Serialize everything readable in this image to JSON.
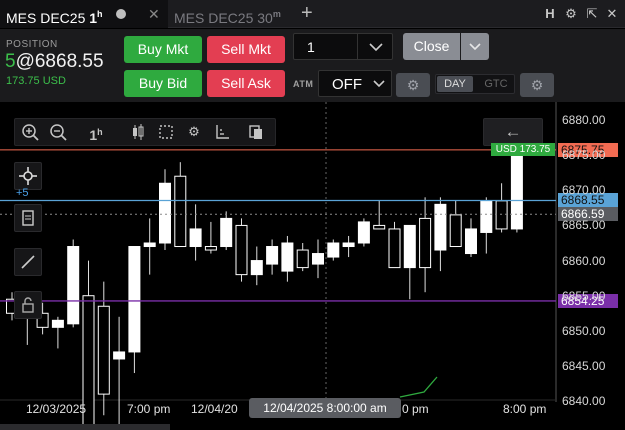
{
  "tabs": [
    {
      "symbol": "MES DEC25",
      "interval": "1",
      "interval_unit": "h",
      "active": true
    },
    {
      "symbol": "MES DEC25",
      "interval": "30",
      "interval_unit": "m",
      "active": false
    }
  ],
  "tab_icons": {
    "add": "+",
    "h": "H",
    "settings": "⚙",
    "popout": "⇱",
    "close": "✕"
  },
  "position": {
    "label": "POSITION",
    "qty": "5",
    "price": "@6868.55",
    "pnl": "173.75 USD"
  },
  "buttons": {
    "buy_mkt": "Buy Mkt",
    "sell_mkt": "Sell Mkt",
    "buy_bid": "Buy Bid",
    "sell_ask": "Sell Ask",
    "close": "Close"
  },
  "quantity": "1",
  "atm": {
    "label": "ATM",
    "value": "OFF"
  },
  "tif": {
    "day": "DAY",
    "gtc": "GTC"
  },
  "chart_toolbar": {
    "interval": "1",
    "interval_unit": "h"
  },
  "plus_offset": "+5",
  "price_tags": {
    "last": "6875.75",
    "entry": "6868.55",
    "crosshair": "6866.59",
    "alert": "6854.25",
    "pnl": "USD 173.75"
  },
  "colors": {
    "last": "#f26b52",
    "entry": "#5aa3d6",
    "crosshair": "#6a6c70",
    "alert": "#7a2fa8",
    "buy": "#2faa3f",
    "sell": "#e33e52"
  },
  "y_axis_labels": [
    "6880.00",
    "6875.00",
    "6870.00",
    "6865.00",
    "6860.00",
    "6855.00",
    "6850.00",
    "6845.00",
    "6840.00"
  ],
  "x_axis_labels": [
    "12/03/2025",
    "7:00 pm",
    "12/04/20",
    "0 pm",
    "8:00 pm"
  ],
  "crosshair_time": "12/04/2025 8:00:00 am",
  "chart_data": {
    "type": "candlestick",
    "ylim": [
      6840,
      6882
    ],
    "candles": [
      {
        "o": 6854.5,
        "h": 6855.5,
        "l": 6851.5,
        "c": 6852.5
      },
      {
        "o": 6852.0,
        "h": 6853.0,
        "l": 6848.0,
        "c": 6854.0
      },
      {
        "o": 6852.5,
        "h": 6854.0,
        "l": 6849.5,
        "c": 6850.5
      },
      {
        "o": 6850.5,
        "h": 6852.0,
        "l": 6847.5,
        "c": 6851.5
      },
      {
        "o": 6851.0,
        "h": 6863.0,
        "l": 6850.5,
        "c": 6862.0
      },
      {
        "o": 6855.0,
        "h": 6860.0,
        "l": 6835.0,
        "c": 6836.0
      },
      {
        "o": 6853.5,
        "h": 6857.0,
        "l": 6838.0,
        "c": 6841.0
      },
      {
        "o": 6846.0,
        "h": 6852.0,
        "l": 6836.0,
        "c": 6847.0
      },
      {
        "o": 6847.0,
        "h": 6862.0,
        "l": 6844.0,
        "c": 6862.0
      },
      {
        "o": 6862.0,
        "h": 6866.0,
        "l": 6858.0,
        "c": 6862.5
      },
      {
        "o": 6862.5,
        "h": 6873.0,
        "l": 6861.5,
        "c": 6871.0
      },
      {
        "o": 6872.0,
        "h": 6874.0,
        "l": 6862.0,
        "c": 6862.0
      },
      {
        "o": 6862.0,
        "h": 6868.0,
        "l": 6860.0,
        "c": 6864.5
      },
      {
        "o": 6862.0,
        "h": 6865.5,
        "l": 6861.0,
        "c": 6861.5
      },
      {
        "o": 6862.0,
        "h": 6867.0,
        "l": 6861.5,
        "c": 6866.0
      },
      {
        "o": 6865.0,
        "h": 6866.0,
        "l": 6857.0,
        "c": 6858.0
      },
      {
        "o": 6858.0,
        "h": 6862.0,
        "l": 6856.5,
        "c": 6860.0
      },
      {
        "o": 6859.5,
        "h": 6863.0,
        "l": 6858.0,
        "c": 6862.0
      },
      {
        "o": 6858.5,
        "h": 6863.5,
        "l": 6857.0,
        "c": 6862.5
      },
      {
        "o": 6861.5,
        "h": 6862.5,
        "l": 6858.5,
        "c": 6859.0
      },
      {
        "o": 6859.5,
        "h": 6863.0,
        "l": 6857.5,
        "c": 6861.0
      },
      {
        "o": 6860.5,
        "h": 6863.0,
        "l": 6860.0,
        "c": 6862.5
      },
      {
        "o": 6862.0,
        "h": 6863.5,
        "l": 6860.5,
        "c": 6862.5
      },
      {
        "o": 6862.5,
        "h": 6866.0,
        "l": 6862.0,
        "c": 6865.5
      },
      {
        "o": 6865.0,
        "h": 6868.5,
        "l": 6864.5,
        "c": 6864.5
      },
      {
        "o": 6864.5,
        "h": 6865.5,
        "l": 6859.0,
        "c": 6859.0
      },
      {
        "o": 6859.0,
        "h": 6865.0,
        "l": 6854.5,
        "c": 6865.0
      },
      {
        "o": 6866.0,
        "h": 6869.0,
        "l": 6855.5,
        "c": 6859.0
      },
      {
        "o": 6861.5,
        "h": 6869.0,
        "l": 6858.5,
        "c": 6868.0
      },
      {
        "o": 6866.5,
        "h": 6868.5,
        "l": 6862.0,
        "c": 6862.0
      },
      {
        "o": 6861.0,
        "h": 6866.0,
        "l": 6860.5,
        "c": 6864.5
      },
      {
        "o": 6864.0,
        "h": 6869.0,
        "l": 6861.0,
        "c": 6868.5
      },
      {
        "o": 6868.5,
        "h": 6871.0,
        "l": 6864.0,
        "c": 6864.5
      },
      {
        "o": 6864.5,
        "h": 6876.0,
        "l": 6864.0,
        "c": 6875.75
      }
    ]
  }
}
